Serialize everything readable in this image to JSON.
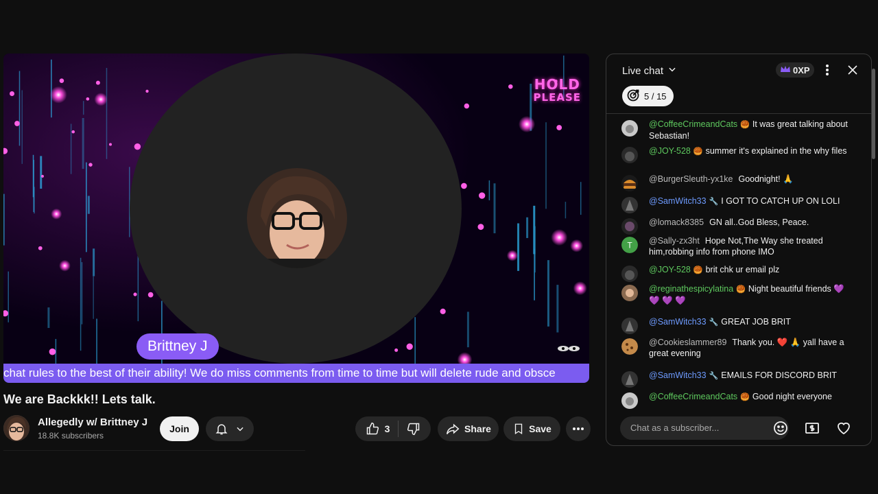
{
  "video": {
    "hold_line1": "HOLD",
    "hold_line2": "PLEASE",
    "streamer_name": "Brittney J",
    "ticker_text": "chat rules to the best of their ability! We do miss comments from time to time but will delete rude and obsce"
  },
  "video_info": {
    "title": "We are Backkk!! Lets talk.",
    "channel_name": "Allegedly w/ Brittney J",
    "subscribers": "18.8K subscribers",
    "join_label": "Join",
    "like_count": "3",
    "share_label": "Share",
    "save_label": "Save"
  },
  "chat": {
    "title": "Live chat",
    "xp": "0XP",
    "goal": "5 / 15",
    "input_placeholder": "Chat as a subscriber...",
    "messages": [
      {
        "user": "@CoffeeCrimeandCats",
        "color": "#5ec95e",
        "badge": "🥮",
        "text": "It was great talking about Sebastian!"
      },
      {
        "user": "@JOY-528",
        "color": "#5ec95e",
        "badge": "🥮",
        "text": "summer it's explained in the why files"
      },
      {
        "user": "@BurgerSleuth-yx1ke",
        "color": "#bbbbbb",
        "badge": "",
        "text": "Goodnight! 🙏"
      },
      {
        "user": "@SamWitch33",
        "color": "#6e9bff",
        "badge": "🔧",
        "text": "I GOT TO CATCH UP ON LOLI"
      },
      {
        "user": "@lomack8385",
        "color": "#bbbbbb",
        "badge": "",
        "text": "GN all..God Bless, Peace."
      },
      {
        "user": "@Sally-zx3ht",
        "color": "#bbbbbb",
        "badge": "",
        "text": "Hope Not,The Way she treated him,robbing info from phone IMO"
      },
      {
        "user": "@JOY-528",
        "color": "#5ec95e",
        "badge": "🥮",
        "text": "brit chk ur email plz"
      },
      {
        "user": "@reginathespicylatina",
        "color": "#5ec95e",
        "badge": "🥮",
        "text": "Night beautiful friends 💜 💜 💜 💜"
      },
      {
        "user": "@SamWitch33",
        "color": "#6e9bff",
        "badge": "🔧",
        "text": "GREAT JOB BRIT"
      },
      {
        "user": "@Cookieslammer89",
        "color": "#bbbbbb",
        "badge": "",
        "text": "Thank you. ❤️ 🙏 yall have a great evening"
      },
      {
        "user": "@SamWitch33",
        "color": "#6e9bff",
        "badge": "🔧",
        "text": "EMAILS FOR DISCORD BRIT"
      },
      {
        "user": "@CoffeeCrimeandCats",
        "color": "#5ec95e",
        "badge": "🥮",
        "text": "Good night everyone"
      }
    ]
  },
  "colors": {
    "accent_purple": "#7b5cf0",
    "bg": "#0f0f0f"
  }
}
